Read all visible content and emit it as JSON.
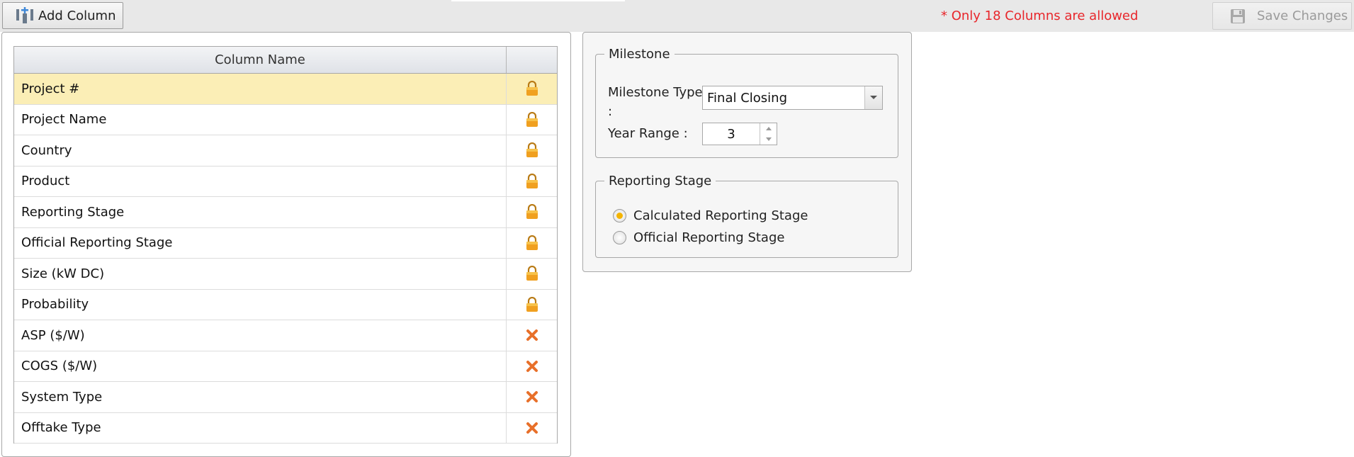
{
  "toolbar": {
    "add_column_label": "Add Column",
    "warning_text": "* Only 18 Columns are allowed",
    "save_label": "Save Changes"
  },
  "grid": {
    "header": "Column Name",
    "rows": [
      {
        "name": "Project #",
        "icon": "lock-icon",
        "selected": true
      },
      {
        "name": "Project Name",
        "icon": "lock-icon"
      },
      {
        "name": "Country",
        "icon": "lock-icon"
      },
      {
        "name": "Product",
        "icon": "lock-icon"
      },
      {
        "name": "Reporting Stage",
        "icon": "lock-icon"
      },
      {
        "name": "Official Reporting Stage",
        "icon": "lock-icon"
      },
      {
        "name": "Size (kW DC)",
        "icon": "lock-icon"
      },
      {
        "name": "Probability",
        "icon": "lock-icon"
      },
      {
        "name": "ASP ($/W)",
        "icon": "remove-icon"
      },
      {
        "name": "COGS ($/W)",
        "icon": "remove-icon"
      },
      {
        "name": "System Type",
        "icon": "remove-icon"
      },
      {
        "name": "Offtake Type",
        "icon": "remove-icon"
      }
    ]
  },
  "milestone": {
    "legend": "Milestone",
    "type_label": "Milestone Type",
    "type_colon": ":",
    "type_value": "Final Closing",
    "year_range_label": "Year Range :",
    "year_range_value": "3"
  },
  "reporting_stage": {
    "legend": "Reporting Stage",
    "options": [
      {
        "label": "Calculated Reporting Stage",
        "checked": true
      },
      {
        "label": "Official Reporting Stage",
        "checked": false
      }
    ]
  },
  "colors": {
    "warning": "#e8262b",
    "selected_row": "#fbeeb6",
    "lock": "#f0a020",
    "remove": "#e8702a"
  }
}
